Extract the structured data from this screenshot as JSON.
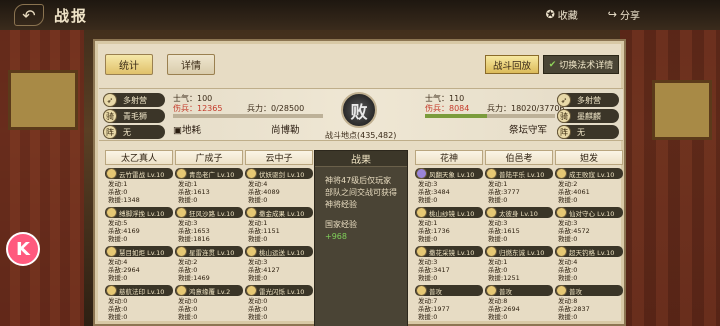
{
  "header": {
    "title": "战报",
    "back_icon": "back-arrow-icon",
    "collect_label": "收藏",
    "share_label": "分享"
  },
  "tabs": {
    "stats": "统计",
    "details": "详情"
  },
  "actions": {
    "replay": "战斗回放",
    "switch": "切换法术详情"
  },
  "battle": {
    "result": "败",
    "place": "战斗地点(435,482)",
    "left": {
      "formations": [
        "多射营",
        "青毛狮",
        "无"
      ],
      "morale_label": "士气：",
      "morale": "100",
      "damage_label": "伤兵：",
      "damage": "12365",
      "troops_label": "兵力：",
      "troops": "0/28500",
      "troop_fraction": 0.0,
      "ground": "地耗",
      "commander": "尚博勒"
    },
    "right": {
      "formations": [
        "多射营",
        "墨麒麟",
        "无"
      ],
      "morale_label": "士气：",
      "morale": "110",
      "damage_label": "伤兵：",
      "damage": "8084",
      "troops_label": "兵力：",
      "troops": "18020/37706",
      "troop_fraction": 0.478,
      "commander": "祭坛守军"
    }
  },
  "result_panel": {
    "title": "战果",
    "text": "神将47级后仅玩家部队之间交战可获得神将经验",
    "exp_label": "国家经验",
    "exp_value": "+968"
  },
  "left_generals": [
    {
      "name": "太乙真人",
      "blocks": [
        {
          "skill": "云竹雷战 Lv.10",
          "stats": [
            "发动:1",
            "杀敌:0",
            "救援:1348"
          ]
        },
        {
          "skill": "缚脚浮挽 Lv.10",
          "stats": [
            "发动:5",
            "杀敌:4169",
            "救援:0"
          ]
        },
        {
          "skill": "慧目如炬 Lv.10",
          "stats": [
            "发动:4",
            "杀敌:2964",
            "救援:0"
          ]
        },
        {
          "skill": "慈航法印 Lv.10",
          "stats": [
            "发动:0",
            "杀敌:0",
            "救援:0"
          ]
        }
      ]
    },
    {
      "name": "广成子",
      "blocks": [
        {
          "skill": "青岛老广 Lv.10",
          "stats": [
            "发动:1",
            "杀敌:1613",
            "救援:0"
          ]
        },
        {
          "skill": "狂风沙路 Lv.10",
          "stats": [
            "发动:3",
            "杀敌:1653",
            "救援:1816"
          ]
        },
        {
          "skill": "星雷连贯 Lv.10",
          "stats": [
            "发动:2",
            "杀敌:0",
            "救援:1469"
          ]
        },
        {
          "skill": "鸿意缘覆 Lv.2",
          "stats": [
            "发动:0",
            "杀敌:0",
            "救援:0"
          ]
        }
      ]
    },
    {
      "name": "云中子",
      "blocks": [
        {
          "skill": "伏妖驱剑 Lv.10",
          "stats": [
            "发动:4",
            "杀敌:4089",
            "救援:0"
          ]
        },
        {
          "skill": "撒金成果 Lv.10",
          "stats": [
            "发动:1",
            "杀敌:1151",
            "救援:0"
          ]
        },
        {
          "skill": "桃山运送 Lv.10",
          "stats": [
            "发动:3",
            "杀敌:4127",
            "救援:0"
          ]
        },
        {
          "skill": "雷光闪烁 Lv.10",
          "stats": [
            "发动:0",
            "杀敌:0",
            "救援:0"
          ]
        }
      ]
    }
  ],
  "right_generals": [
    {
      "name": "花神",
      "blocks": [
        {
          "skill": "风翻天象 Lv.10",
          "stats": [
            "发动:3",
            "杀敌:3484",
            "救援:0"
          ]
        },
        {
          "skill": "桃山纱镜 Lv.10",
          "stats": [
            "发动:1",
            "杀敌:1736",
            "救援:0"
          ]
        },
        {
          "skill": "撒花采镜 Lv.10",
          "stats": [
            "发动:3",
            "杀敌:3417",
            "救援:0"
          ]
        },
        {
          "skill": "普攻",
          "stats": [
            "发动:7",
            "杀敌:1977",
            "救援:0"
          ]
        }
      ]
    },
    {
      "name": "伯邑考",
      "blocks": [
        {
          "skill": "普陆平乐 Lv.10",
          "stats": [
            "发动:1",
            "杀敌:3777",
            "救援:0"
          ]
        },
        {
          "skill": "太彼身 Lv.10",
          "stats": [
            "发动:3",
            "杀敌:1615",
            "救援:0"
          ]
        },
        {
          "skill": "归燃东诚 Lv.10",
          "stats": [
            "发动:1",
            "杀敌:0",
            "救援:1251"
          ]
        },
        {
          "skill": "普攻",
          "stats": [
            "发动:8",
            "杀敌:2694",
            "救援:0"
          ]
        }
      ]
    },
    {
      "name": "妲发",
      "blocks": [
        {
          "skill": "成王败寇 Lv.10",
          "stats": [
            "发动:2",
            "杀敌:4061",
            "救援:0"
          ]
        },
        {
          "skill": "仙对守心 Lv.10",
          "stats": [
            "发动:3",
            "杀敌:4572",
            "救援:0"
          ]
        },
        {
          "skill": "超天钓格 Lv.10",
          "stats": [
            "发动:4",
            "杀敌:0",
            "救援:0"
          ]
        },
        {
          "skill": "普攻",
          "stats": [
            "发动:8",
            "杀敌:2837",
            "救援:0"
          ]
        }
      ]
    }
  ],
  "colors": {
    "accent": "#e0c16a",
    "red": "#c43a2a",
    "green": "#7fd05a",
    "panel": "#e7dcc4"
  }
}
